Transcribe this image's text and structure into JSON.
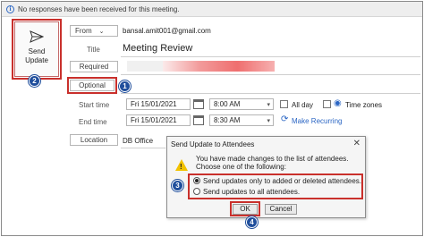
{
  "infobar": {
    "text": "No responses have been received for this meeting."
  },
  "send": {
    "label": "Send\nUpdate"
  },
  "from": {
    "button": "From",
    "value": "bansal.amit001@gmail.com"
  },
  "title": {
    "label": "Title",
    "value": "Meeting Review"
  },
  "required": {
    "label": "Required"
  },
  "optional": {
    "label": "Optional"
  },
  "start": {
    "label": "Start time",
    "date": "Fri 15/01/2021",
    "time": "8:00 AM"
  },
  "end": {
    "label": "End time",
    "date": "Fri 15/01/2021",
    "time": "8:30 AM"
  },
  "allday": {
    "label": "All day"
  },
  "timezones": {
    "label": "Time zones"
  },
  "recurring": {
    "label": "Make Recurring"
  },
  "location": {
    "button": "Location",
    "value": "DB Office"
  },
  "dialog": {
    "title": "Send Update to Attendees",
    "message": "You have made changes to the list of attendees. Choose one of the following:",
    "option1": "Send updates only to added or deleted attendees.",
    "option2": "Send updates to all attendees.",
    "ok": "OK",
    "cancel": "Cancel",
    "selected": "option1"
  },
  "badges": {
    "b1": "1",
    "b2": "2",
    "b3": "3",
    "b4": "4"
  },
  "colors": {
    "annotation_red": "#c9302c",
    "badge_blue": "#1f4e9c",
    "link_blue": "#2b66c4"
  }
}
